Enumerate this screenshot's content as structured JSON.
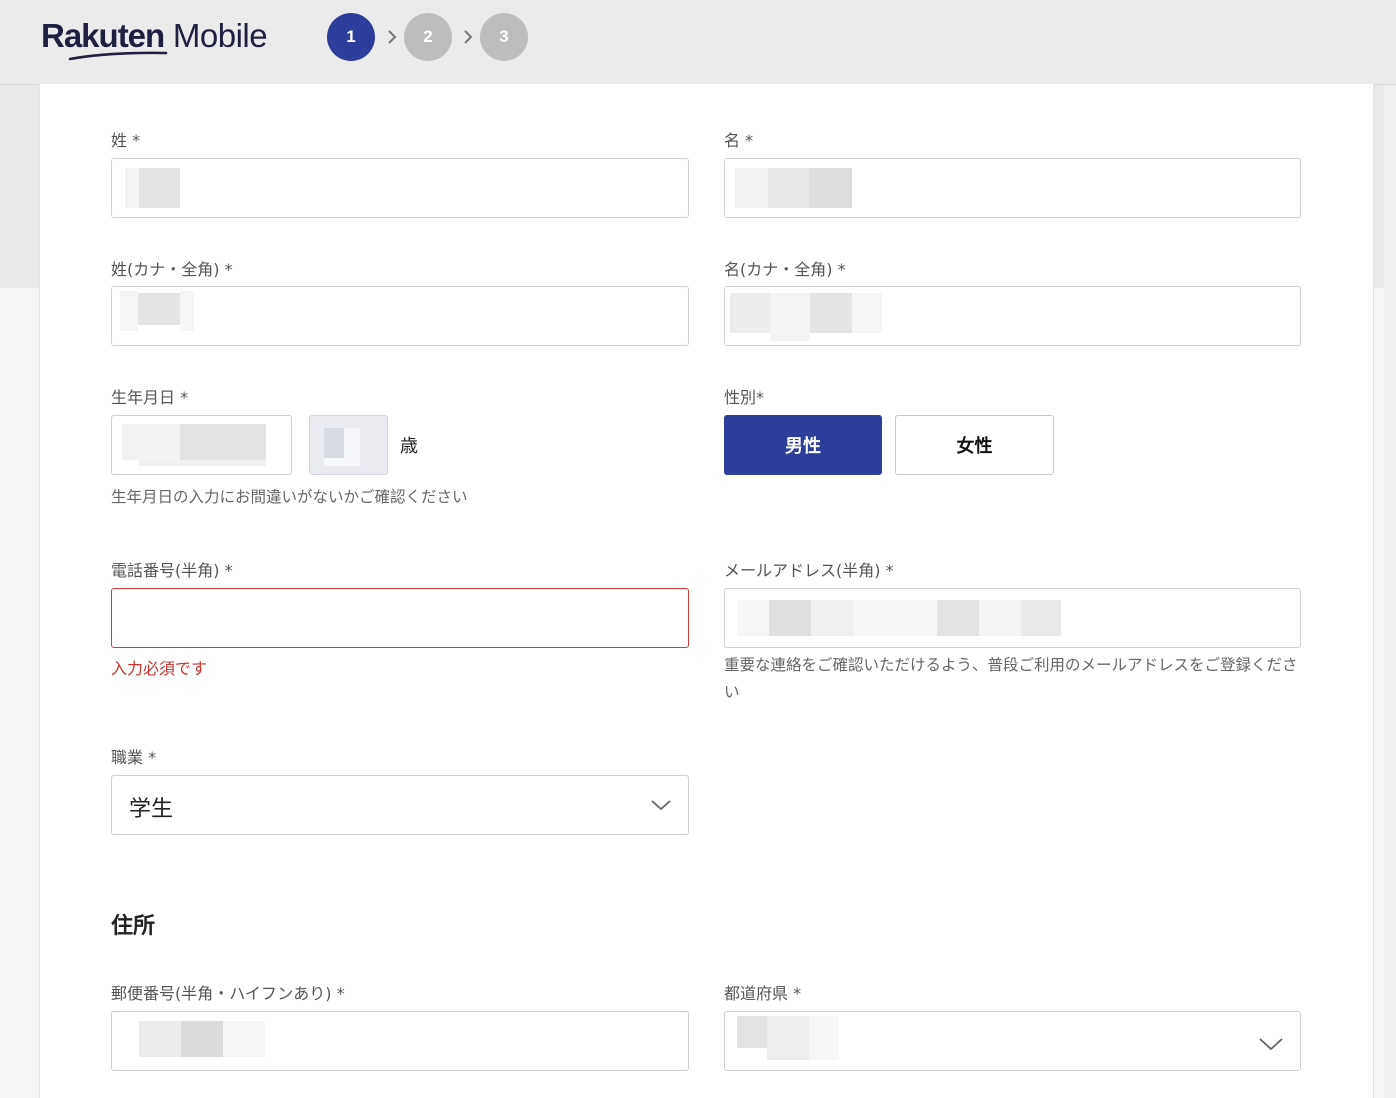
{
  "brand": {
    "bold": "Rakuten",
    "light": "Mobile"
  },
  "steps": [
    "1",
    "2",
    "3"
  ],
  "form": {
    "last_name_label": "姓 *",
    "first_name_label": "名 *",
    "last_kana_label": "姓(カナ・全角) *",
    "first_kana_label": "名(カナ・全角) *",
    "birthday_label": "生年月日 *",
    "age_suffix": "歳",
    "birthday_hint": "生年月日の入力にお間違いがないかご確認ください",
    "gender_label": "性別*",
    "gender_male": "男性",
    "gender_female": "女性",
    "phone_label": "電話番号(半角) *",
    "phone_error": "入力必須です",
    "email_label": "メールアドレス(半角) *",
    "email_hint": "重要な連絡をご確認いただけるよう、普段ご利用のメールアドレスをご登録ください",
    "job_label": "職業 *",
    "job_value": "学生",
    "address_section": "住所",
    "postal_label": "郵便番号(半角・ハイフンあり) *",
    "prefecture_label": "都道府県 *"
  },
  "colors": {
    "accent": "#2e3d9a",
    "error": "#c8342f"
  }
}
